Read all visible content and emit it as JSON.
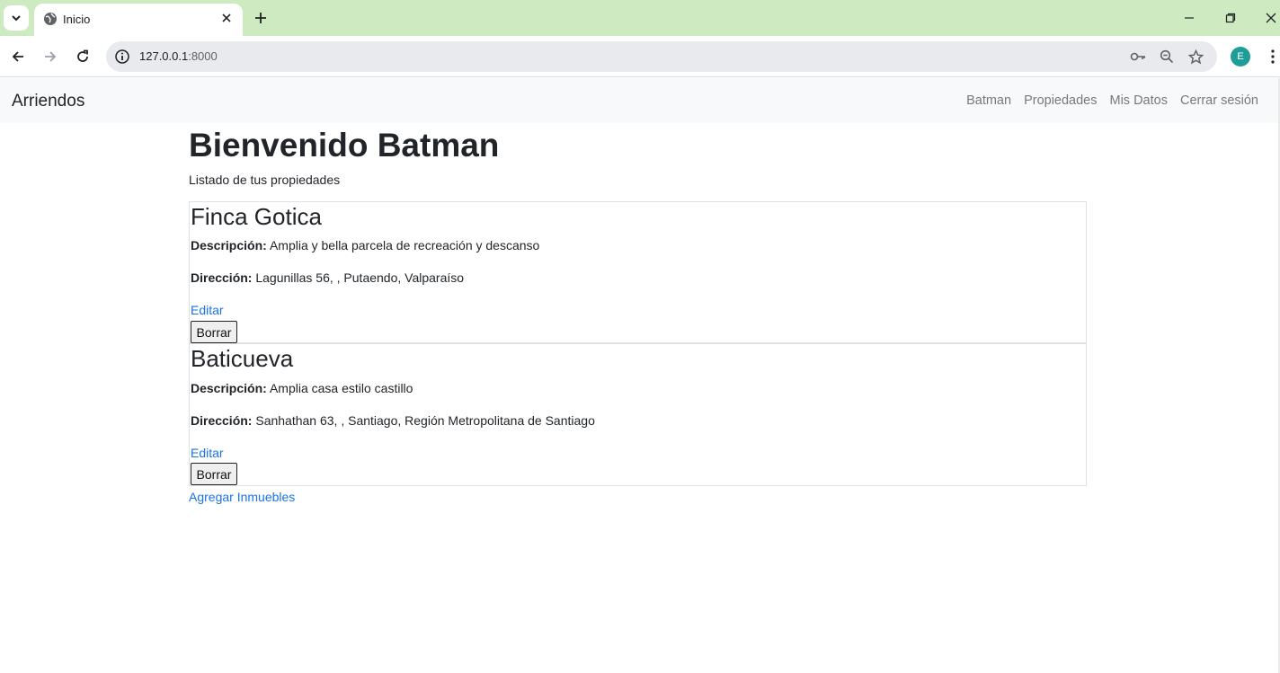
{
  "browser": {
    "tab_title": "Inicio",
    "url_host": "127.0.0.1",
    "url_port": ":8000",
    "profile_initial": "E",
    "icons": {
      "tab_search": "chevron-down-icon",
      "tab_favicon": "globe-icon",
      "tab_close": "close-icon",
      "new_tab": "plus-icon",
      "minimize": "minimize-icon",
      "restore": "restore-icon",
      "close_window": "close-icon",
      "back": "back-arrow-icon",
      "forward": "forward-arrow-icon",
      "reload": "reload-icon",
      "site_info": "info-icon",
      "password": "key-icon",
      "zoom": "zoom-icon",
      "bookmark": "star-icon",
      "menu": "kebab-menu-icon"
    }
  },
  "navbar": {
    "brand": "Arriendos",
    "links": [
      "Batman",
      "Propiedades",
      "Mis Datos",
      "Cerrar sesión"
    ]
  },
  "main": {
    "heading": "Bienvenido Batman",
    "subtitle": "Listado de tus propiedades",
    "description_label": "Descripción:",
    "address_label": "Dirección:",
    "edit_label": "Editar",
    "delete_label": "Borrar",
    "properties": [
      {
        "name": "Finca Gotica",
        "description": "Amplia y bella parcela de recreación y descanso",
        "address": "Lagunillas 56, , Putaendo, Valparaíso"
      },
      {
        "name": "Baticueva",
        "description": "Amplia casa estilo castillo",
        "address": "Sanhathan 63, , Santiago, Región Metropolitana de Santiago"
      }
    ],
    "add_link": "Agregar Inmuebles"
  },
  "colors": {
    "tabbar_bg": "#cdeac0",
    "navbar_bg": "#f8f9fa",
    "link": "#1a73e8",
    "profile": "#1e9e96"
  }
}
